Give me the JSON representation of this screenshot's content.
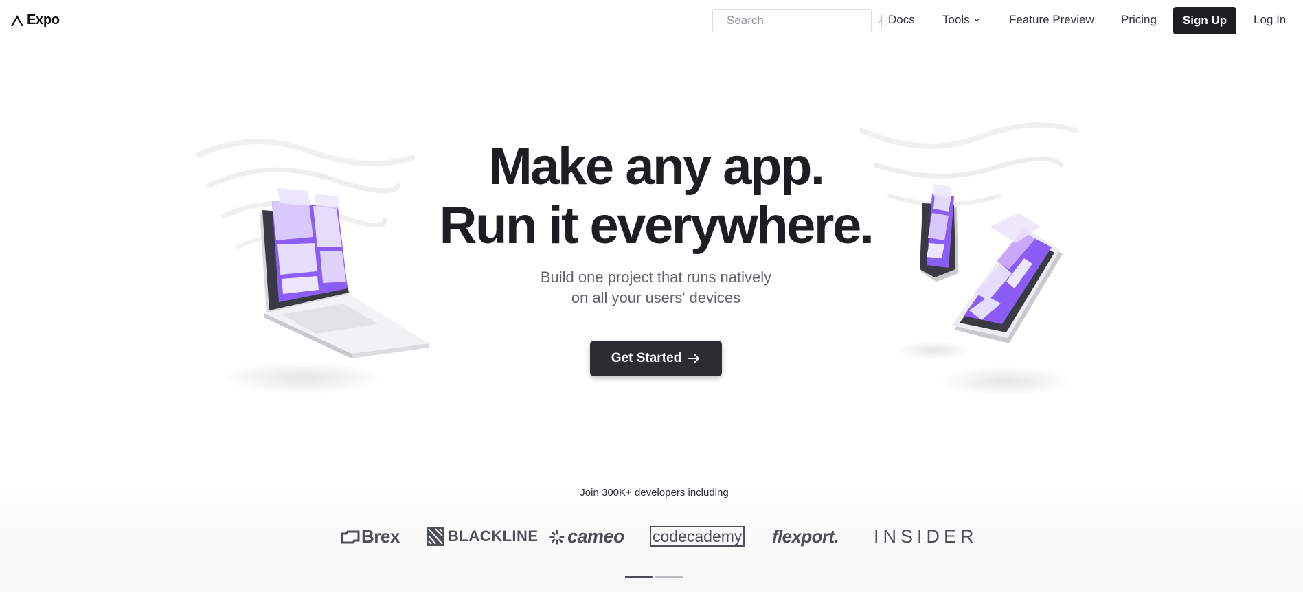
{
  "nav": {
    "logo_text": "Expo",
    "search_placeholder": "Search",
    "search_shortcut": "/",
    "links": {
      "docs": "Docs",
      "tools": "Tools",
      "feature_preview": "Feature Preview",
      "pricing": "Pricing",
      "sign_up": "Sign Up",
      "log_in": "Log In"
    }
  },
  "hero": {
    "title_line1": "Make any app.",
    "title_line2": "Run it everywhere.",
    "subtitle_line1": "Build one project that runs natively",
    "subtitle_line2": "on all your users' devices",
    "cta_label": "Get Started"
  },
  "social_proof": {
    "heading": "Join 300K+ developers including",
    "companies": [
      "Brex",
      "BLACKLINE",
      "cameo",
      "codecademy",
      "flexport.",
      "INSIDER"
    ],
    "carousel_pages": 2,
    "carousel_active": 1
  },
  "colors": {
    "accent_purple": "#8b5cf6",
    "dark_button": "#1c1e22",
    "text_primary": "#1c1e21"
  }
}
